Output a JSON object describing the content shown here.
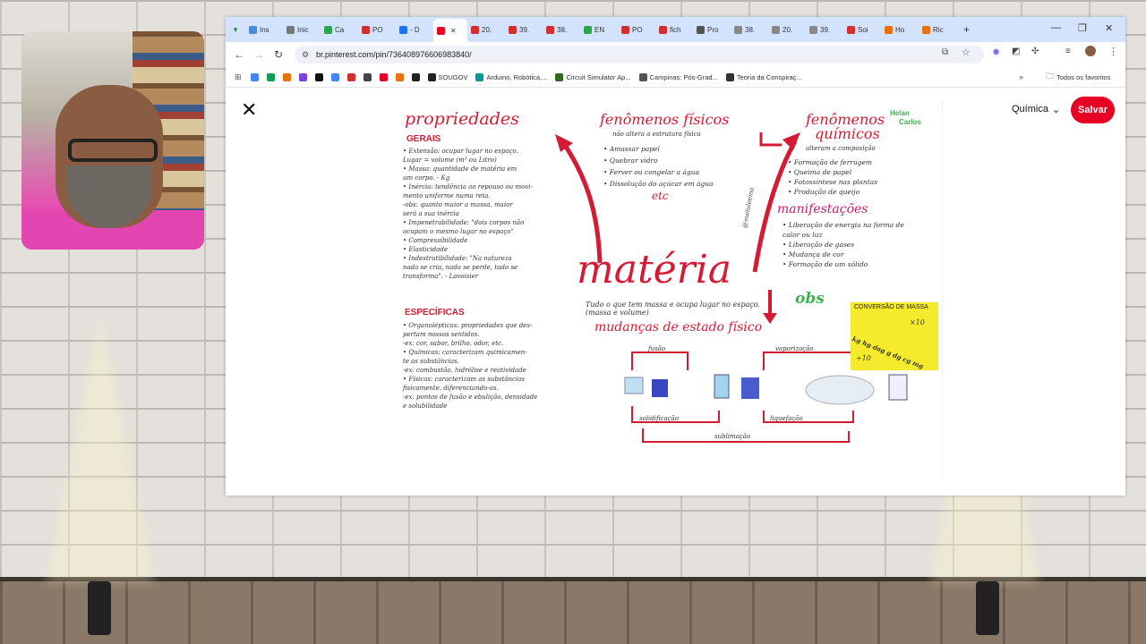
{
  "browser": {
    "tabs": [
      {
        "label": "Ins",
        "color": "#4a89dc"
      },
      {
        "label": "Inic",
        "color": "#777"
      },
      {
        "label": "Ca",
        "color": "#2da44e"
      },
      {
        "label": "PO",
        "color": "#d32f2f"
      },
      {
        "label": "- D",
        "color": "#1a73e8"
      },
      {
        "label": "",
        "color": "#e60023"
      },
      {
        "label": "20.",
        "color": "#d32f2f"
      },
      {
        "label": "39.",
        "color": "#d32f2f"
      },
      {
        "label": "38.",
        "color": "#d32f2f"
      },
      {
        "label": "EN",
        "color": "#2da44e"
      },
      {
        "label": "PO",
        "color": "#d32f2f"
      },
      {
        "label": "fich",
        "color": "#d32f2f"
      },
      {
        "label": "Pro",
        "color": "#555"
      },
      {
        "label": "38.",
        "color": "#888"
      },
      {
        "label": "20.",
        "color": "#888"
      },
      {
        "label": "39.",
        "color": "#888"
      },
      {
        "label": "Soi",
        "color": "#d32f2f"
      },
      {
        "label": "Ho",
        "color": "#e8710a"
      },
      {
        "label": "Ric",
        "color": "#e8710a"
      }
    ],
    "url": "br.pinterest.com/pin/736408976606983840/",
    "bookmarks": [
      {
        "label": "",
        "color": "#4285f4"
      },
      {
        "label": "",
        "color": "#0f9d58"
      },
      {
        "label": "",
        "color": "#e8710a"
      },
      {
        "label": "",
        "color": "#7b3fe4"
      },
      {
        "label": "",
        "color": "#111"
      },
      {
        "label": "",
        "color": "#4285f4"
      },
      {
        "label": "",
        "color": "#d32f2f"
      },
      {
        "label": "",
        "color": "#444"
      },
      {
        "label": "",
        "color": "#e60023"
      },
      {
        "label": "",
        "color": "#e8710a"
      },
      {
        "label": "",
        "color": "#222"
      },
      {
        "label": "SOUGOV",
        "color": "#222"
      },
      {
        "label": "Arduino, Robótica,...",
        "color": "#00979d"
      },
      {
        "label": "Circuit Simulator Ap...",
        "color": "#2d6a1f"
      },
      {
        "label": "Campinas: Pós-Grad...",
        "color": "#555"
      },
      {
        "label": "Teoria da Conspiraç...",
        "color": "#333"
      }
    ],
    "all_bookmarks_label": "Todos os favoritos"
  },
  "pinterest": {
    "board": "Química",
    "save_label": "Salvar"
  },
  "mindmap": {
    "center": "matéria",
    "center_def": "Tudo o que tem massa e ocupa lugar no espaço. (massa e volume)",
    "left_title": "propriedades",
    "gerais": "GERAIS",
    "gerais_items": [
      "• Extensão: ocupar lugar no espaço.",
      "Lugar = volume (m³ ou Litro)",
      "• Massa: quantidade de matéria em",
      "um corpo. - Kg",
      "• Inércia: tendência ao repouso ou movi-",
      "mento uniforme numa reta.",
      "-obs: quanto maior a massa, maior",
      "será a sua inércia",
      "• Impenetrabilidade: \"dois corpos não",
      "ocupam o mesmo lugar no espaço\"",
      "• Compressibilidade",
      "• Elasticidade",
      "• Indestrutibilidade: \"Na natureza",
      "nada se cria, nada se perde, tudo se",
      "transforma\". - Lavoisier"
    ],
    "especificas": "ESPECÍFICAS",
    "especificas_items": [
      "• Organolépticas: propriedades que des-",
      "pertam nossos sentidos.",
      "-ex: cor, sabor, brilho, odor, etc.",
      "• Químicas: caracterizam quimicamen-",
      "te as substâncias.",
      "-ex: combustão, hidrólise e reatividade",
      "• Físicas: caracterizam as substâncias",
      "fisicamente, diferenciando-as.",
      "-ex: pontos de fusão e ebulição, densidade",
      "e solubilidade"
    ],
    "fis_title": "fenômenos físicos",
    "fis_sub": "não altera a estrutura física",
    "fis_items": [
      "• Amassar papel",
      "• Quebrar vidro",
      "• Ferver ou congelar a água",
      "• Dissolução do açúcar em água"
    ],
    "fis_etc": "etc",
    "qui_title_1": "fenômenos",
    "qui_title_2": "químicos",
    "qui_sub": "alteram a composição",
    "qui_items": [
      "• Formação de ferrugem",
      "• Queima de papel",
      "• Fotossíntese nas plantas",
      "• Produção de queijo"
    ],
    "manif_title": "manifestações",
    "manif_items": [
      "• Liberação de energia na forma de",
      "calor ou luz",
      "• Liberação de gases",
      "• Mudança de cor",
      "• Formação de um sólido"
    ],
    "side_credit": "@meluleema",
    "obs": "obs",
    "mass_title": "CONVERSÃO DE MASSA",
    "mass_scale": "kg hg dag g dg cg mg",
    "mass_mult": "×10",
    "mass_div": "÷10",
    "states_title": "mudanças de estado físico",
    "fusao": "fusão",
    "vaporizacao": "vaporização",
    "solidificacao": "solidificação",
    "liquefacao": "liquefação",
    "sublimacao": "sublimação",
    "logo_1": "Helan",
    "logo_2": "Carlos"
  }
}
